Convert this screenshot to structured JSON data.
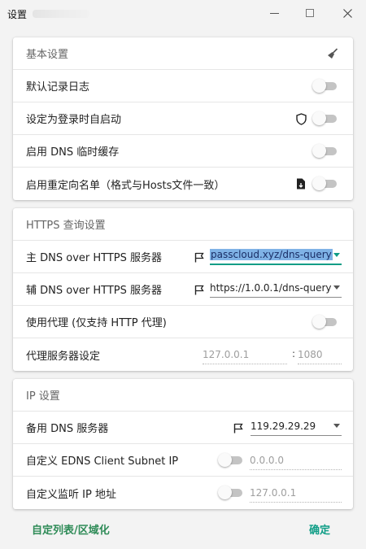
{
  "window": {
    "title": "设置"
  },
  "basic": {
    "header": "基本设置",
    "rows": [
      {
        "label": "默认记录日志"
      },
      {
        "label": "设定为登录时自启动"
      },
      {
        "label": "启用 DNS 临时缓存"
      },
      {
        "label": "启用重定向名单（格式与Hosts文件一致）"
      }
    ]
  },
  "https": {
    "header": "HTTPS 查询设置",
    "primary": {
      "label": "主 DNS over HTTPS 服务器",
      "value": "passcloud.xyz/dns-query"
    },
    "secondary": {
      "label": "辅 DNS over HTTPS 服务器",
      "value": "https://1.0.0.1/dns-query"
    },
    "proxy": {
      "label": "使用代理 (仅支持 HTTP 代理)"
    },
    "proxy_server": {
      "label": "代理服务器设定",
      "host_placeholder": "127.0.0.1",
      "separator": ":",
      "port_placeholder": "1080"
    }
  },
  "ip": {
    "header": "IP 设置",
    "backup": {
      "label": "备用 DNS 服务器",
      "value": "119.29.29.29"
    },
    "ecs": {
      "label": "自定义 EDNS Client Subnet IP",
      "placeholder": "0.0.0.0"
    },
    "listen": {
      "label": "自定义监听 IP 地址",
      "placeholder": "127.0.0.1"
    }
  },
  "footer": {
    "left_button": "自定列表/区域化",
    "right_button": "确定"
  },
  "colors": {
    "accent": "#0f9d86",
    "footer_text": "#2e8b57",
    "selection": "#7fb2e6"
  },
  "icons": [
    "broom-icon",
    "shield-icon",
    "file-icon",
    "flag-icon"
  ]
}
